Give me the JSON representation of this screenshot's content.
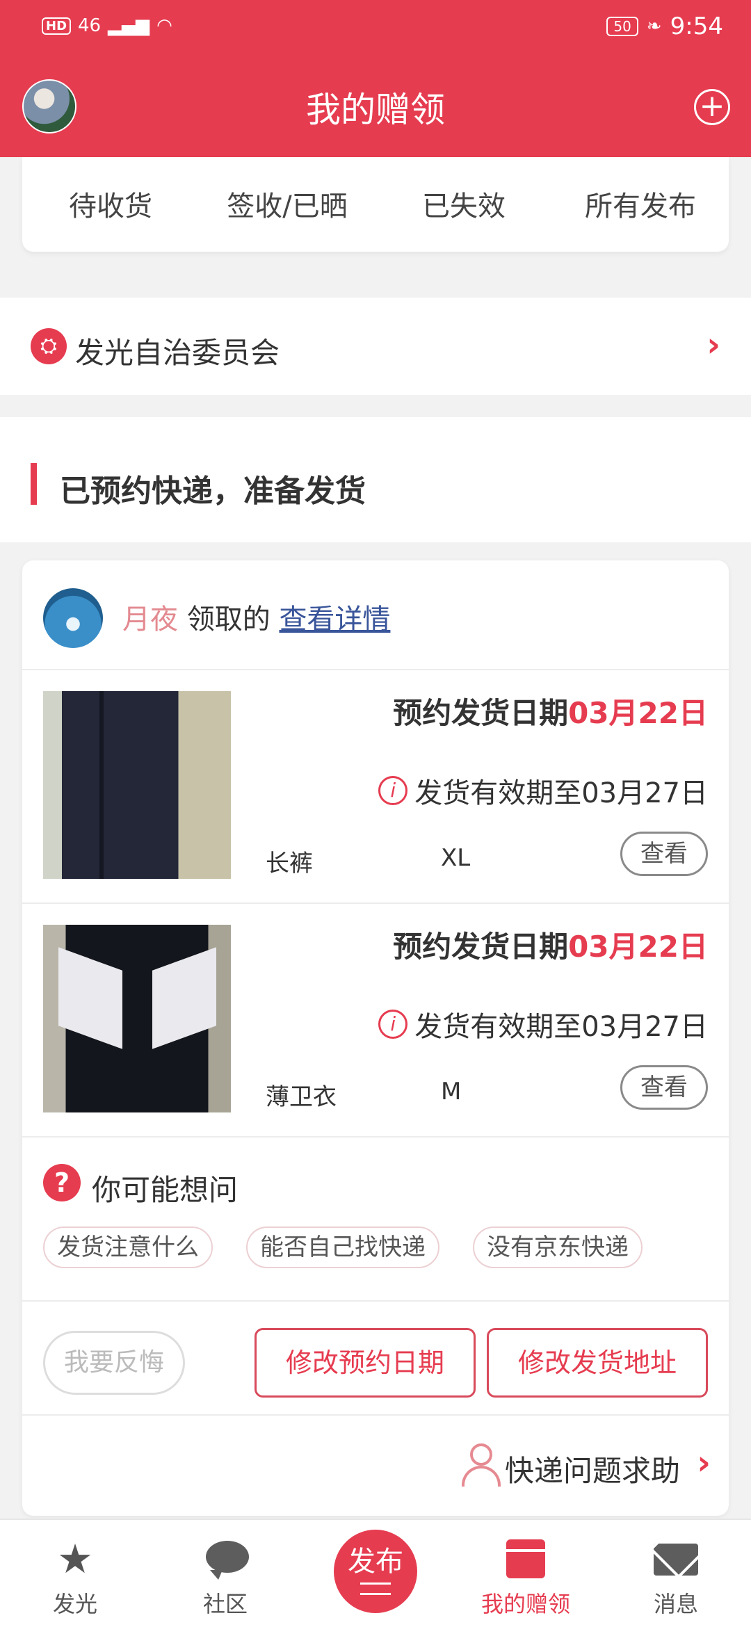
{
  "status_bar": {
    "network": "46",
    "battery": "50",
    "time": "9:54"
  },
  "header": {
    "title": "我的赠领"
  },
  "stats": [
    {
      "label": "待收货"
    },
    {
      "label": "签收/已晒"
    },
    {
      "label": "已失效"
    },
    {
      "label": "所有发布"
    }
  ],
  "committee": {
    "label": "发光自治委员会"
  },
  "section": {
    "title": "已预约快递，准备发货"
  },
  "claimer": {
    "nickname": "月夜",
    "action": "领取的",
    "detail_link": "查看详情"
  },
  "items": [
    {
      "date_prefix": "预约发货日期",
      "date_value": "03月22日",
      "valid_text": "发货有效期至03月27日",
      "name": "长裤",
      "size": "XL",
      "view_label": "查看"
    },
    {
      "date_prefix": "预约发货日期",
      "date_value": "03月22日",
      "valid_text": "发货有效期至03月27日",
      "name": "薄卫衣",
      "size": "M",
      "view_label": "查看"
    }
  ],
  "faq": {
    "title": "你可能想问",
    "chips": [
      "发货注意什么",
      "能否自己找快递",
      "没有京东快递"
    ]
  },
  "actions": {
    "regret": "我要反悔",
    "change_date": "修改预约日期",
    "change_address": "修改发货地址"
  },
  "help": {
    "label": "快递问题求助"
  },
  "tabbar": {
    "tabs": [
      "发光",
      "社区",
      "发布",
      "我的赠领",
      "消息"
    ],
    "active_index": 3
  },
  "colors": {
    "accent": "#e63c50",
    "nickname": "#e38a90",
    "link": "#39559a"
  }
}
